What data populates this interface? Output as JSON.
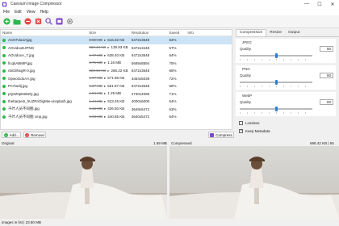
{
  "app": {
    "title": "Caesium Image Compressor"
  },
  "menu": [
    "File",
    "Edit",
    "View",
    "Help"
  ],
  "window_controls": {
    "minimize": "—",
    "maximize": "☐",
    "close": "✕"
  },
  "table": {
    "columns": [
      "Name",
      "Size",
      "Resolution",
      "Saved",
      "Info"
    ],
    "rows": [
      {
        "name": "ACNTdoxiAjpg",
        "old": "1.59 MB",
        "new": "616.82 KB",
        "res": "5472x3648",
        "saved": "62%"
      },
      {
        "name": "AOUdooEJPNG",
        "old": "326.44 KB",
        "new": "139.93 KB",
        "res": "5472x3448",
        "saved": "57%"
      },
      {
        "name": "AOUdoxA_7.jpg",
        "old": "1.77 MB",
        "new": "638.40 KB",
        "res": "5472x3648",
        "saved": "64%"
      },
      {
        "name": "ficqkABMIP.jpg",
        "old": "4.75 MB",
        "new": "1.16 MB",
        "res": "5689x8594",
        "saved": "75%"
      },
      {
        "name": "nbGilNxgR-0.jpg",
        "old": "823.66 KB",
        "new": "286.22 KB",
        "res": "5472x3648",
        "saved": "65%"
      },
      {
        "name": "OpwoGdoAA.jpg",
        "old": "1.97 MB",
        "new": "571.86 KB",
        "res": "3464x5039",
        "saved": "72%"
      },
      {
        "name": "Pn7iwdij.jpg",
        "old": "1.27 MB",
        "new": "551.87 KB",
        "res": "5472x3648",
        "saved": "58%"
      },
      {
        "name": "pQ2Z0pD692Q.jpg",
        "old": "4.50 MB",
        "new": "1.29 MB",
        "res": "2730x4096",
        "saved": "71%"
      },
      {
        "name": "thebarpein_hUZRriOlgMw-unsplash.jpg",
        "old": "1.44 MB",
        "new": "523.45 KB",
        "res": "4000x6000",
        "saved": "64%"
      },
      {
        "name": "千叶人员不同图.jpg",
        "old": "1.13 MB",
        "new": "426.50 KB",
        "res": "3648x5472",
        "saved": "63%"
      },
      {
        "name": "千叶人员不同图 cmp.jpg",
        "old": "1.03 MB",
        "new": "440.85 KB",
        "res": "3640x5472",
        "saved": "64%"
      }
    ]
  },
  "tabs": [
    "Compression",
    "Resize",
    "Output"
  ],
  "formats": [
    {
      "name": "JPEG",
      "quality_label": "Quality",
      "quality": "50",
      "thumb_pct": 0.5
    },
    {
      "name": "PNG",
      "quality_label": "Quality",
      "quality": "50",
      "thumb_pct": 0.5
    },
    {
      "name": "WebP",
      "quality_label": "Quality",
      "quality": "50",
      "thumb_pct": 0.5
    }
  ],
  "options": {
    "lossless": "Lossless",
    "lossless_checked": false,
    "keep_metadata": "Keep Metadata",
    "keep_metadata_checked": true
  },
  "buttons": {
    "add": "Add...",
    "remove": "Remove",
    "compress": "Compress"
  },
  "compare": {
    "original_label": "Original",
    "original_size": "1.69 MB",
    "compressed_label": "Compressed",
    "compressed_size": "698.42 KB | 65"
  },
  "status": {
    "text": "images in list | 23.80 MB"
  },
  "colors": {
    "accent": "#2f7fd3",
    "selected_row": "#cde4f7",
    "ok_dot": "#2db84d",
    "remove": "#e54848",
    "add": "#2db84d",
    "compress": "#7d4cc9"
  }
}
